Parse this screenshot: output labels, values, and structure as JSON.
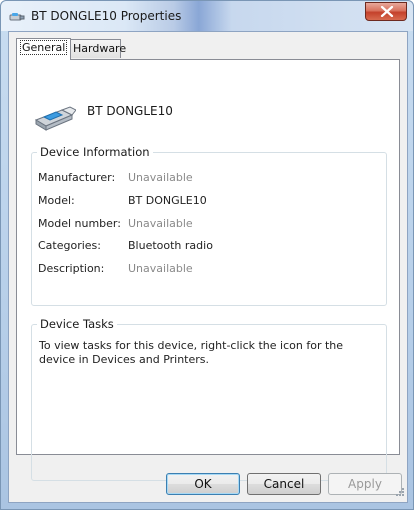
{
  "window": {
    "title": "BT DONGLE10 Properties",
    "icon": "bluetooth-device-icon"
  },
  "titlebar": {
    "close_icon": "close-icon"
  },
  "tabs": [
    {
      "label": "General",
      "active": true
    },
    {
      "label": "Hardware",
      "active": false
    }
  ],
  "device": {
    "name": "BT DONGLE10",
    "icon": "usb-dongle-icon"
  },
  "device_information": {
    "title": "Device Information",
    "rows": [
      {
        "label": "Manufacturer:",
        "value": "Unavailable"
      },
      {
        "label": "Model:",
        "value": "BT DONGLE10"
      },
      {
        "label": "Model number:",
        "value": "Unavailable"
      },
      {
        "label": "Categories:",
        "value": "Bluetooth radio"
      },
      {
        "label": "Description:",
        "value": "Unavailable"
      }
    ]
  },
  "device_tasks": {
    "title": "Device Tasks",
    "text": "To view tasks for this device, right-click the icon for the device in Devices and Printers."
  },
  "buttons": {
    "ok": "OK",
    "cancel": "Cancel",
    "apply": "Apply"
  },
  "colors": {
    "unavailable_text": "#8a8a8a",
    "close_button": "#c4412b"
  }
}
